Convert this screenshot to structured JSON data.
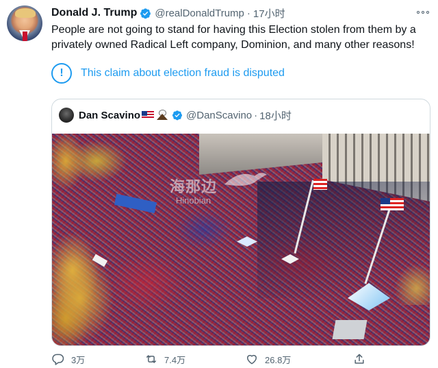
{
  "tweet": {
    "author_name": "Donald J. Trump",
    "handle": "@realDonaldTrump",
    "separator": "·",
    "time": "17小时",
    "text": "People are not going to stand for having this Election stolen from them by a privately owned Radical Left company, Dominion, and many other reasons!",
    "notice": "This claim about election fraud is disputed"
  },
  "quoted": {
    "author_name": "Dan Scavino",
    "handle": "@DanScavino",
    "separator": "·",
    "time": "18小时",
    "image_watermark": {
      "cn": "海那边",
      "en": "Hinobian"
    }
  },
  "actions": {
    "reply_count": "3万",
    "retweet_count": "7.4万",
    "like_count": "26.8万"
  },
  "colors": {
    "accent": "#1d9bf0",
    "text": "#0f1419",
    "muted": "#536471",
    "border": "#cfd9de"
  },
  "icons": [
    "verified-badge-icon",
    "more-icon",
    "info-icon",
    "reply-icon",
    "retweet-icon",
    "like-icon",
    "share-icon"
  ]
}
